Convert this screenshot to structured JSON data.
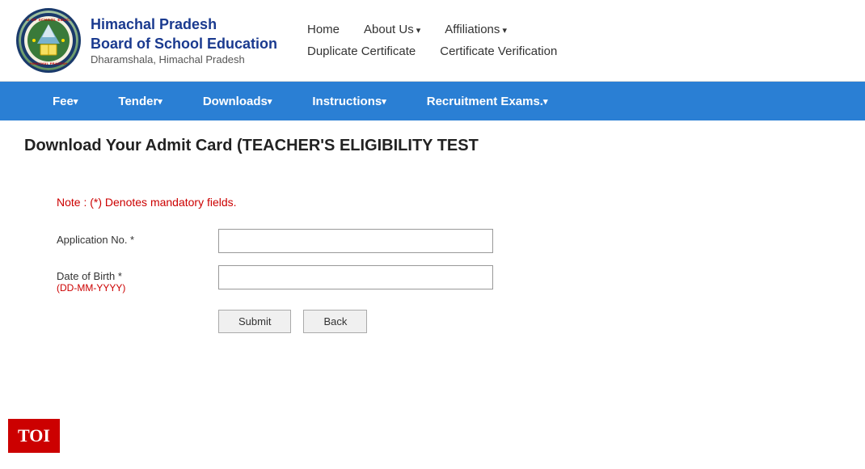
{
  "header": {
    "org_line1": "Himachal Pradesh",
    "org_line2": "Board of School Education",
    "org_line3": "Dharamshala, Himachal Pradesh",
    "nav_row1": [
      {
        "label": "Home",
        "arrow": false
      },
      {
        "label": "About Us",
        "arrow": true
      },
      {
        "label": "Affiliations",
        "arrow": true
      }
    ],
    "nav_row2": [
      {
        "label": "Duplicate Certificate",
        "arrow": false
      },
      {
        "label": "Certificate Verification",
        "arrow": false
      }
    ]
  },
  "navbar": {
    "items": [
      {
        "label": "Fee",
        "arrow": true
      },
      {
        "label": "Tender",
        "arrow": true
      },
      {
        "label": "Downloads",
        "arrow": true
      },
      {
        "label": "Instructions",
        "arrow": true
      },
      {
        "label": "Recruitment Exams.",
        "arrow": true
      }
    ]
  },
  "main": {
    "page_title": "Download Your Admit Card (TEACHER'S ELIGIBILITY TEST",
    "note": "Note  : (*) Denotes mandatory fields.",
    "form": {
      "app_no_label": "Application No. *",
      "dob_label": "Date of Birth *",
      "dob_sublabel": "(DD-MM-YYYY)",
      "app_no_placeholder": "",
      "dob_placeholder": "",
      "submit_label": "Submit",
      "back_label": "Back"
    }
  },
  "toi": {
    "label": "TOI"
  }
}
